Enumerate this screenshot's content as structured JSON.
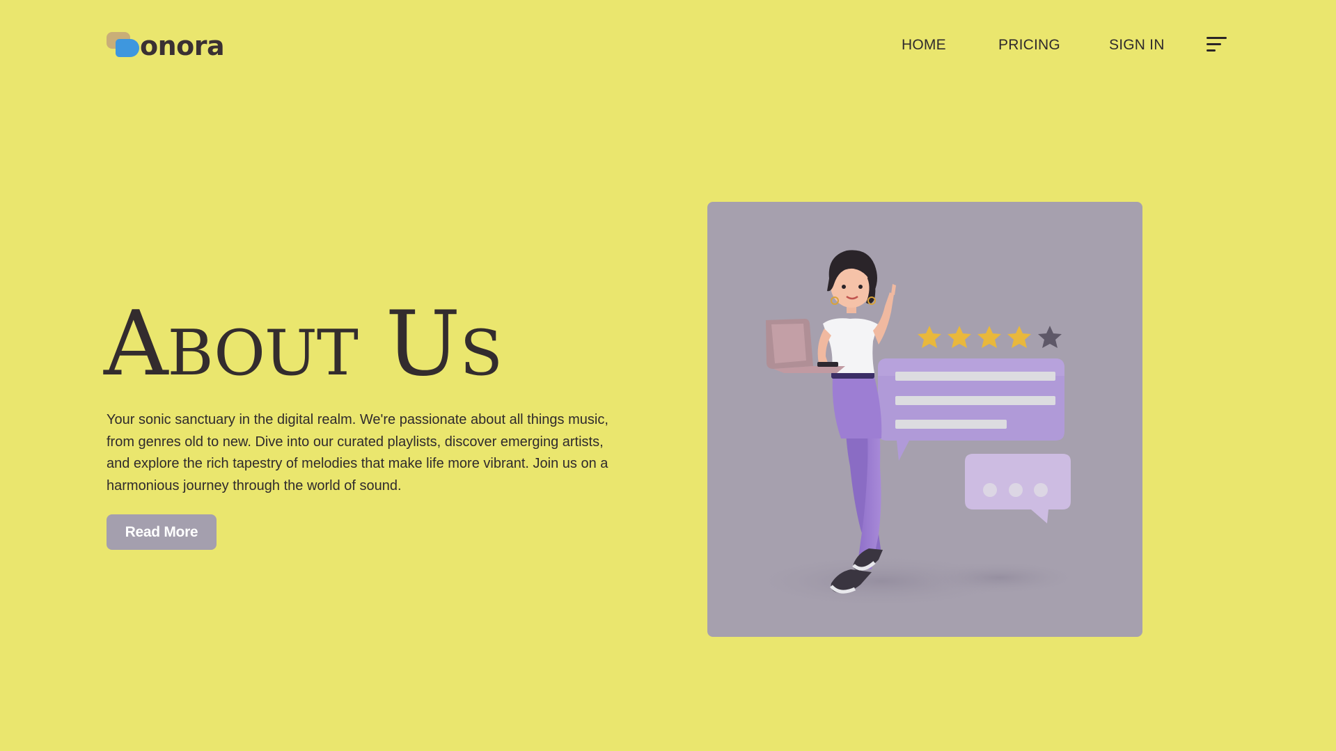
{
  "brand": {
    "name": "onora",
    "colors": {
      "background": "#EAE66E",
      "logo_tan": "#C9AE78",
      "logo_blue": "#3E97DE",
      "button": "#A49FAE",
      "card": "#A6A0AE"
    }
  },
  "nav": {
    "items": [
      {
        "label": "HOME"
      },
      {
        "label": "PRICING"
      },
      {
        "label": "SIGN IN"
      }
    ],
    "menu_icon": "hamburger-menu-icon"
  },
  "hero": {
    "title": "About Us",
    "description": "Your sonic sanctuary in the digital realm. We're passionate about all things music, from genres old to new. Dive into our curated playlists, discover emerging artists, and explore the rich tapestry of melodies that make life more vibrant. Join us on a harmonious journey through the world of sound.",
    "button_label": "Read More"
  },
  "illustration": {
    "subject": "woman-with-laptop-rating-illustration",
    "rating": {
      "filled_stars": 4,
      "total_stars": 5
    }
  }
}
